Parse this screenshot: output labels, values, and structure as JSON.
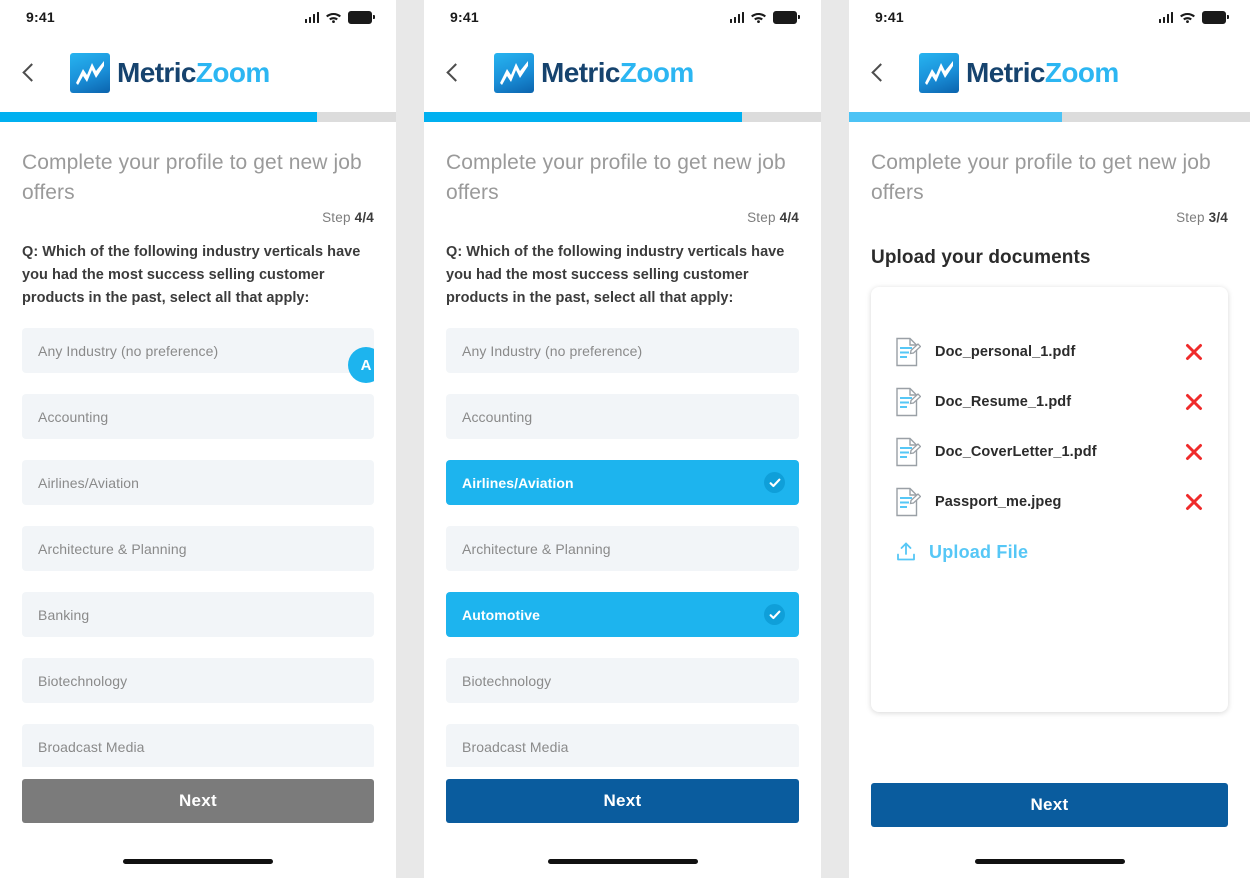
{
  "brand": {
    "name_dark": "Metric",
    "name_light": "Zoom",
    "color_dark": "#16436e",
    "color_light": "#2cb6f2",
    "accent": "#00b0f0",
    "accent_dark": "#0a5c9e"
  },
  "status_bar": {
    "time": "9:41",
    "icons": [
      "cellular-signal-icon",
      "wifi-icon",
      "battery-icon"
    ]
  },
  "panels": [
    {
      "id": "panel-industry-unselected",
      "progress_percent": 80,
      "progress_color": "#00b0f0",
      "headline": "Complete your profile to get new job offers",
      "step_prefix": "Step ",
      "step_value": "4/4",
      "question": "Q: Which of the following industry verticals have you had the most success selling customer products in the past, select all that apply:",
      "options": [
        {
          "label": "Any Industry (no preference)",
          "selected": false
        },
        {
          "label": "Accounting",
          "selected": false
        },
        {
          "label": "Airlines/Aviation",
          "selected": false
        },
        {
          "label": "Architecture & Planning",
          "selected": false
        },
        {
          "label": "Banking",
          "selected": false
        },
        {
          "label": "Biotechnology",
          "selected": false
        },
        {
          "label": "Broadcast Media",
          "selected": false
        }
      ],
      "scroll_badge": "A",
      "next_label": "Next",
      "next_state": "disabled"
    },
    {
      "id": "panel-industry-selected",
      "progress_percent": 80,
      "progress_color": "#00b0f0",
      "headline": "Complete your profile to get new job offers",
      "step_prefix": "Step ",
      "step_value": "4/4",
      "question": "Q: Which of the following industry verticals have you had the most success selling customer products in the past, select all that apply:",
      "options": [
        {
          "label": "Any Industry (no preference)",
          "selected": false
        },
        {
          "label": "Accounting",
          "selected": false
        },
        {
          "label": "Airlines/Aviation",
          "selected": true
        },
        {
          "label": "Architecture & Planning",
          "selected": false
        },
        {
          "label": "Automotive",
          "selected": true
        },
        {
          "label": "Biotechnology",
          "selected": false
        },
        {
          "label": "Broadcast Media",
          "selected": false
        }
      ],
      "next_label": "Next",
      "next_state": "active"
    },
    {
      "id": "panel-documents",
      "progress_percent": 53,
      "progress_color": "#4cc3f5",
      "headline": "Complete your profile to get new job offers",
      "step_prefix": "Step ",
      "step_value": "3/4",
      "subheading": "Upload your documents",
      "documents": [
        {
          "name": "Doc_personal_1.pdf"
        },
        {
          "name": "Doc_Resume_1.pdf"
        },
        {
          "name": "Doc_CoverLetter_1.pdf"
        },
        {
          "name": "Passport_me.jpeg"
        }
      ],
      "upload_label": "Upload File",
      "next_label": "Next",
      "next_state": "active"
    }
  ]
}
